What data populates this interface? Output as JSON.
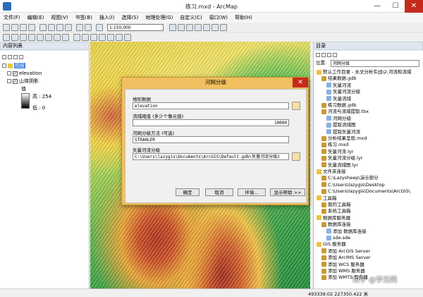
{
  "window": {
    "title": "练习.mxd - ArcMap",
    "minimize": "—",
    "maximize": "☐",
    "close": "✕"
  },
  "menu": [
    "文件(F)",
    "编辑(E)",
    "视图(V)",
    "书签(B)",
    "插入(I)",
    "选择(S)",
    "地理处理(G)",
    "自定义(C)",
    "窗口(W)",
    "帮助(H)"
  ],
  "toolbar": {
    "scale": "1:150,000"
  },
  "toc": {
    "title": "内容列表",
    "layer_group": "图层",
    "layers": [
      "elevation",
      "山体阴影"
    ],
    "legend_label": "值",
    "high": "高 : 254",
    "low": "低 : 0"
  },
  "catalog": {
    "title": "目录",
    "location_label": "位置:",
    "location_value": "河网分级",
    "items": [
      "默认工作目录 - 水文分析实战\\2.河流和流域",
      "结果数据.gdb",
      "矢量河流",
      "矢量河流分级",
      "矢量流域",
      "练习数据.gdb",
      "河流与流域提取.tbx",
      "河网分级",
      "提取流域图",
      "提取矢量河流",
      "分析结果呈现.mxd",
      "练习.mxd",
      "矢量河流.lyr",
      "矢量河流分级.lyr",
      "矢量流域图.lyr",
      "文件夹连接",
      "C:\\Lazysheep\\演示部分",
      "C:\\Users\\lazygis\\Desktop",
      "C:\\Users\\lazygis\\Documents\\ArcGIS\\",
      "工具箱",
      "我的工具箱",
      "系统工具箱",
      "数据库服务器",
      "数据库连接",
      "添加 数据库连接",
      "sde.sde",
      "GIS 服务器",
      "添加 ArcGIS Server",
      "添加 ArcIMS Server",
      "添加 WCS 服务器",
      "添加 WMS 服务器",
      "添加 WMTS 服务器"
    ]
  },
  "dialog": {
    "title": "河网分级",
    "fields": [
      {
        "label": "地形数据",
        "value": "elevation"
      },
      {
        "label": "流域阈值 (多少个像元值)",
        "value": "10000"
      },
      {
        "label": "河网分级方法 (可选)",
        "value": "STRAHLER"
      },
      {
        "label": "矢量河流分级",
        "value": "C:\\Users\\lazygis\\Documents\\ArcGIS\\Default.gdb\\矢量河流分级2"
      }
    ],
    "buttons": {
      "ok": "确定",
      "cancel": "取消",
      "env": "环境...",
      "help": "显示帮助 >>"
    }
  },
  "status": {
    "coords": "493339.02  227350.422 米"
  },
  "watermark": "知乎 @学无网"
}
